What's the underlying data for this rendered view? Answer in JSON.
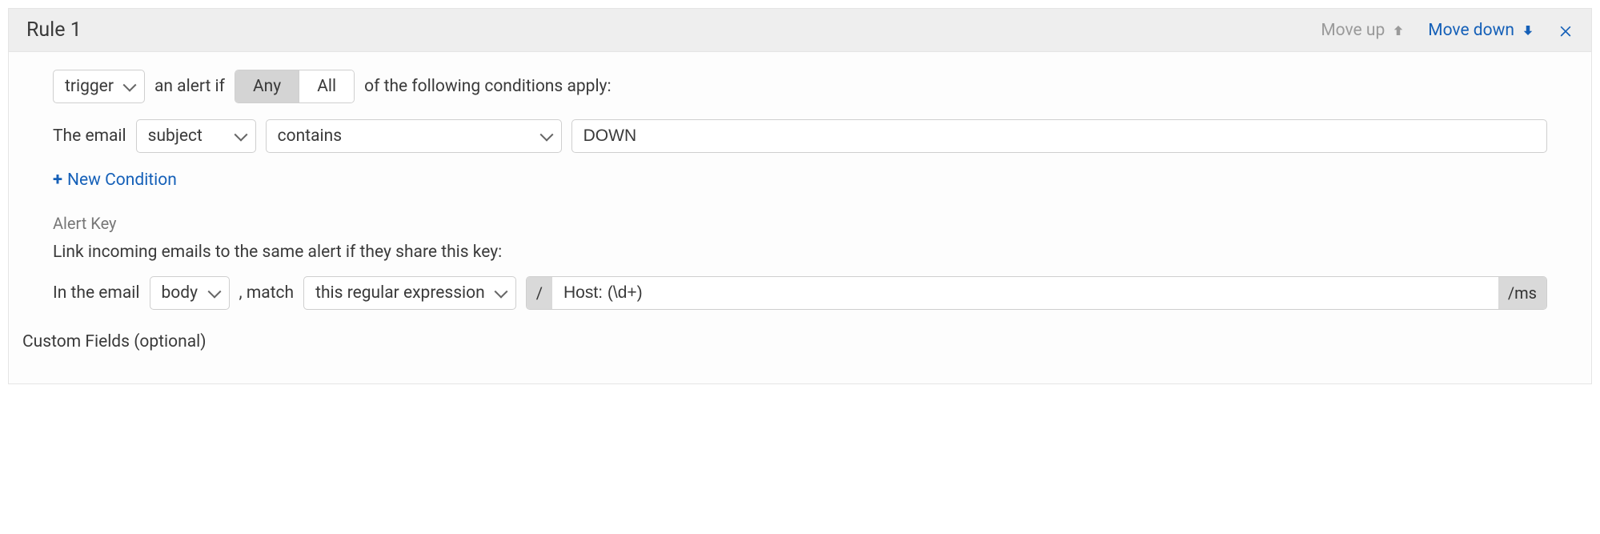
{
  "rule": {
    "title": "Rule 1",
    "actions": {
      "move_up": "Move up",
      "move_down": "Move down"
    }
  },
  "trigger": {
    "select_label": "trigger",
    "text_before_toggle": "an alert if",
    "toggle": {
      "any": "Any",
      "all": "All",
      "active": "any"
    },
    "text_after_toggle": "of the following conditions apply:"
  },
  "condition": {
    "prefix": "The email",
    "field": "subject",
    "operator": "contains",
    "value": "DOWN"
  },
  "new_condition_label": "New Condition",
  "alert_key": {
    "heading": "Alert Key",
    "description": "Link incoming emails to the same alert if they share this key:",
    "prefix": "In the email",
    "source": "body",
    "middle_text": ", match",
    "match_type": "this regular expression",
    "regex": {
      "open": "/",
      "value": "Host: (\\d+)",
      "close": "/ms"
    }
  },
  "custom_fields_label": "Custom Fields (optional)"
}
